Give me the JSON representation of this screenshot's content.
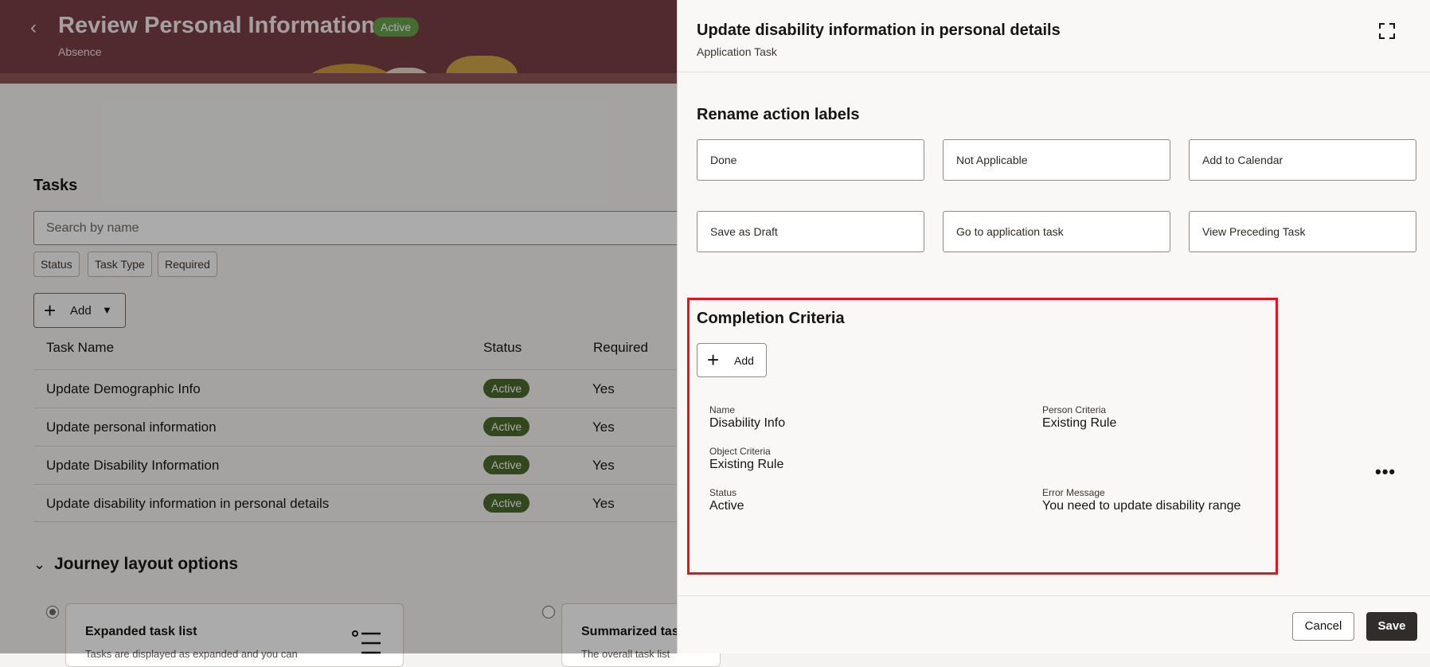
{
  "background_page": {
    "title": "Review Personal Information",
    "status_badge": "Active",
    "subtitle": "Absence",
    "tasks_title": "Tasks",
    "search_placeholder": "Search by name",
    "filters": [
      "Status",
      "Task Type",
      "Required"
    ],
    "add_label": "Add",
    "table": {
      "headers": [
        "Task Name",
        "Status",
        "Required"
      ],
      "rows": [
        {
          "name": "Update Demographic Info",
          "status": "Active",
          "required": "Yes"
        },
        {
          "name": "Update personal information",
          "status": "Active",
          "required": "Yes"
        },
        {
          "name": "Update Disability Information",
          "status": "Active",
          "required": "Yes"
        },
        {
          "name": "Update disability information in personal details",
          "status": "Active",
          "required": "Yes"
        }
      ]
    },
    "journey_layout_title": "Journey layout options",
    "layout_cards": [
      {
        "title": "Expanded task list",
        "desc": "Tasks are displayed as expanded and you can"
      },
      {
        "title": "Summarized tas",
        "desc": "The overall task list"
      }
    ]
  },
  "drawer": {
    "title": "Update disability information in personal details",
    "subtitle": "Application Task",
    "rename_title": "Rename action labels",
    "action_labels": [
      "Done",
      "Not Applicable",
      "Add to Calendar",
      "Save as Draft",
      "Go to application task",
      "View Preceding Task"
    ],
    "completion": {
      "title": "Completion Criteria",
      "add_label": "Add",
      "fields": {
        "name_label": "Name",
        "name_value": "Disability Info",
        "person_label": "Person Criteria",
        "person_value": "Existing Rule",
        "object_label": "Object Criteria",
        "object_value": "Existing Rule",
        "status_label": "Status",
        "status_value": "Active",
        "error_label": "Error Message",
        "error_value": "You need to update disability range"
      }
    },
    "more_icon": "•••",
    "cancel_label": "Cancel",
    "save_label": "Save"
  },
  "colors": {
    "hero": "#7a3f46",
    "status_active": "#4b6b2c",
    "highlight_border": "#e3131f",
    "save_button": "#312d2a"
  }
}
